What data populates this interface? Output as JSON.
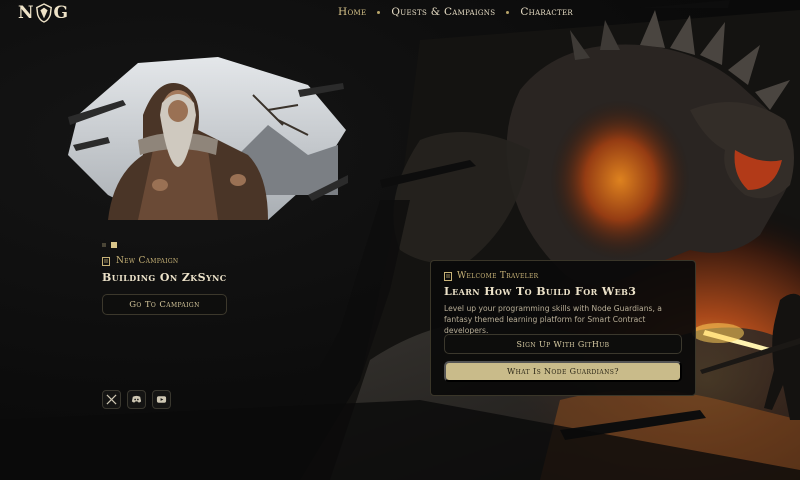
{
  "brand": {
    "logo_left": "N",
    "logo_right": "G"
  },
  "nav": {
    "items": [
      {
        "label": "Home",
        "active": true
      },
      {
        "label": "Quests & Campaigns",
        "active": false
      },
      {
        "label": "Character",
        "active": false
      }
    ]
  },
  "campaign": {
    "tag": "New Campaign",
    "title": "Building On ZkSync",
    "button": "Go To Campaign",
    "pager": {
      "count": 2,
      "active": 2
    }
  },
  "socials": [
    {
      "icon": "x-icon"
    },
    {
      "icon": "discord-icon"
    },
    {
      "icon": "youtube-icon"
    }
  ],
  "welcome": {
    "tag": "Welcome Traveler",
    "title": "Learn How To Build For Web3",
    "description": "Level up your programming skills with Node Guardians, a fantasy themed learning platform for Smart Contract developers.",
    "github_button": "Sign Up With GitHub",
    "what_button": "What Is Node Guardians?"
  },
  "colors": {
    "accent": "#c9bb8a",
    "gold_text": "#c9b478",
    "background": "#0a0a0a"
  }
}
